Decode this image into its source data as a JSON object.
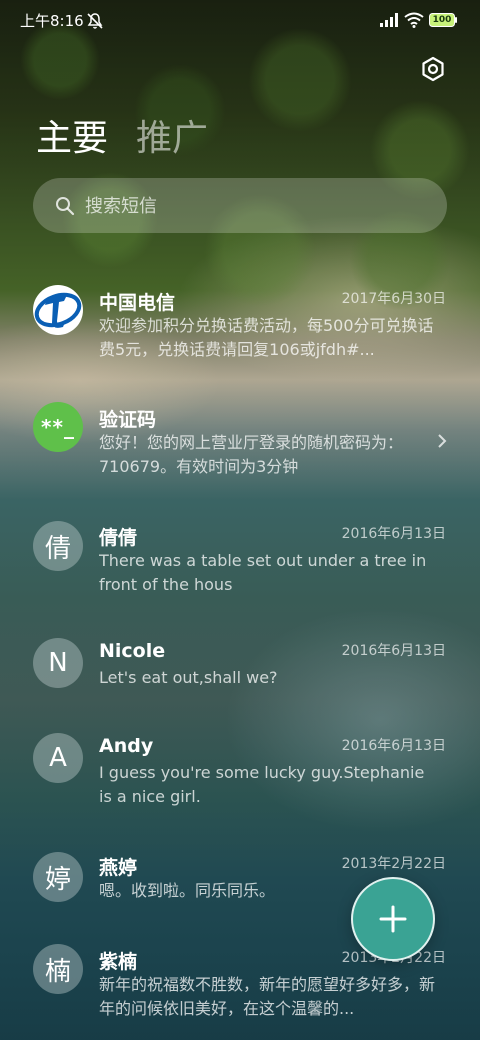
{
  "status_bar": {
    "time": "上午8:16",
    "battery": "100",
    "icons": [
      "mute-icon",
      "signal-icon",
      "wifi-icon",
      "battery-icon"
    ]
  },
  "header": {
    "settings_icon": "gear-icon",
    "tabs": [
      {
        "label": "主要",
        "active": true
      },
      {
        "label": "推广",
        "active": false
      }
    ]
  },
  "search": {
    "placeholder": "搜索短信",
    "icon": "search-icon"
  },
  "conversations": [
    {
      "sender": "中国电信",
      "date": "2017年6月30日",
      "preview": "欢迎参加积分兑换话费活动，每500分可兑换话费5元，兑换话费请回复106或jfdh#...",
      "avatar": "china-telecom-logo"
    },
    {
      "sender": "验证码",
      "date": "",
      "preview": "您好！您的网上营业厅登录的随机密码为：710679。有效时间为3分钟",
      "avatar_text": "**_"
    },
    {
      "sender": "倩倩",
      "date": "2016年6月13日",
      "preview": "There was a table set out under a tree in front of the hous",
      "avatar_text": "倩"
    },
    {
      "sender": "Nicole",
      "date": "2016年6月13日",
      "preview": "Let's eat out,shall we?",
      "avatar_text": "N"
    },
    {
      "sender": "Andy",
      "date": "2016年6月13日",
      "preview": "I guess you're some lucky guy.Stephanie is a nice girl.",
      "avatar_text": "A"
    },
    {
      "sender": "燕婷",
      "date": "2013年2月22日",
      "preview": "嗯。收到啦。同乐同乐。",
      "avatar_text": "婷"
    },
    {
      "sender": "紫楠",
      "date": "2013年2月22日",
      "preview": "新年的祝福数不胜数，新年的愿望好多好多，新年的问候依旧美好，在这个温馨的...",
      "avatar_text": "楠"
    }
  ],
  "fab": {
    "icon": "plus-icon"
  },
  "colors": {
    "fab": "#3aa394",
    "verification_avatar": "#5fc04a",
    "telecom_blue": "#0a5fb4"
  }
}
